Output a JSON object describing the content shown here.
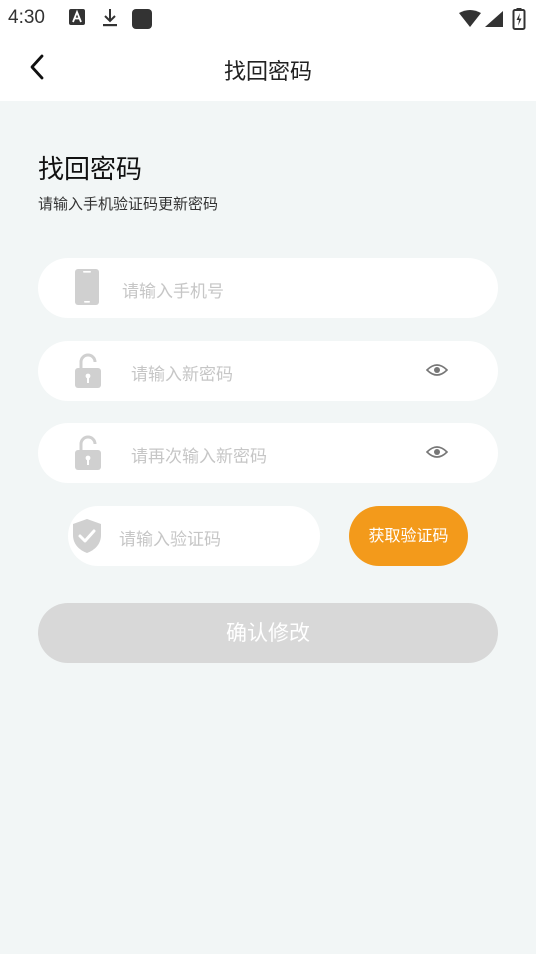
{
  "status_bar": {
    "time": "4:30"
  },
  "nav": {
    "title": "找回密码",
    "back_icon": "chevron-left-icon"
  },
  "page": {
    "heading": "找回密码",
    "subheading": "请输入手机验证码更新密码"
  },
  "form": {
    "phone_placeholder": "请输入手机号",
    "new_password_placeholder": "请输入新密码",
    "confirm_password_placeholder": "请再次输入新密码",
    "code_placeholder": "请输入验证码",
    "get_code_label": "获取验证码",
    "submit_label": "确认修改"
  },
  "colors": {
    "accent": "#f39a1b",
    "background": "#f2f6f6",
    "disabled_button": "#d8d8d8",
    "placeholder": "#c6c6c6",
    "icon_gray": "#d0d0d0"
  }
}
